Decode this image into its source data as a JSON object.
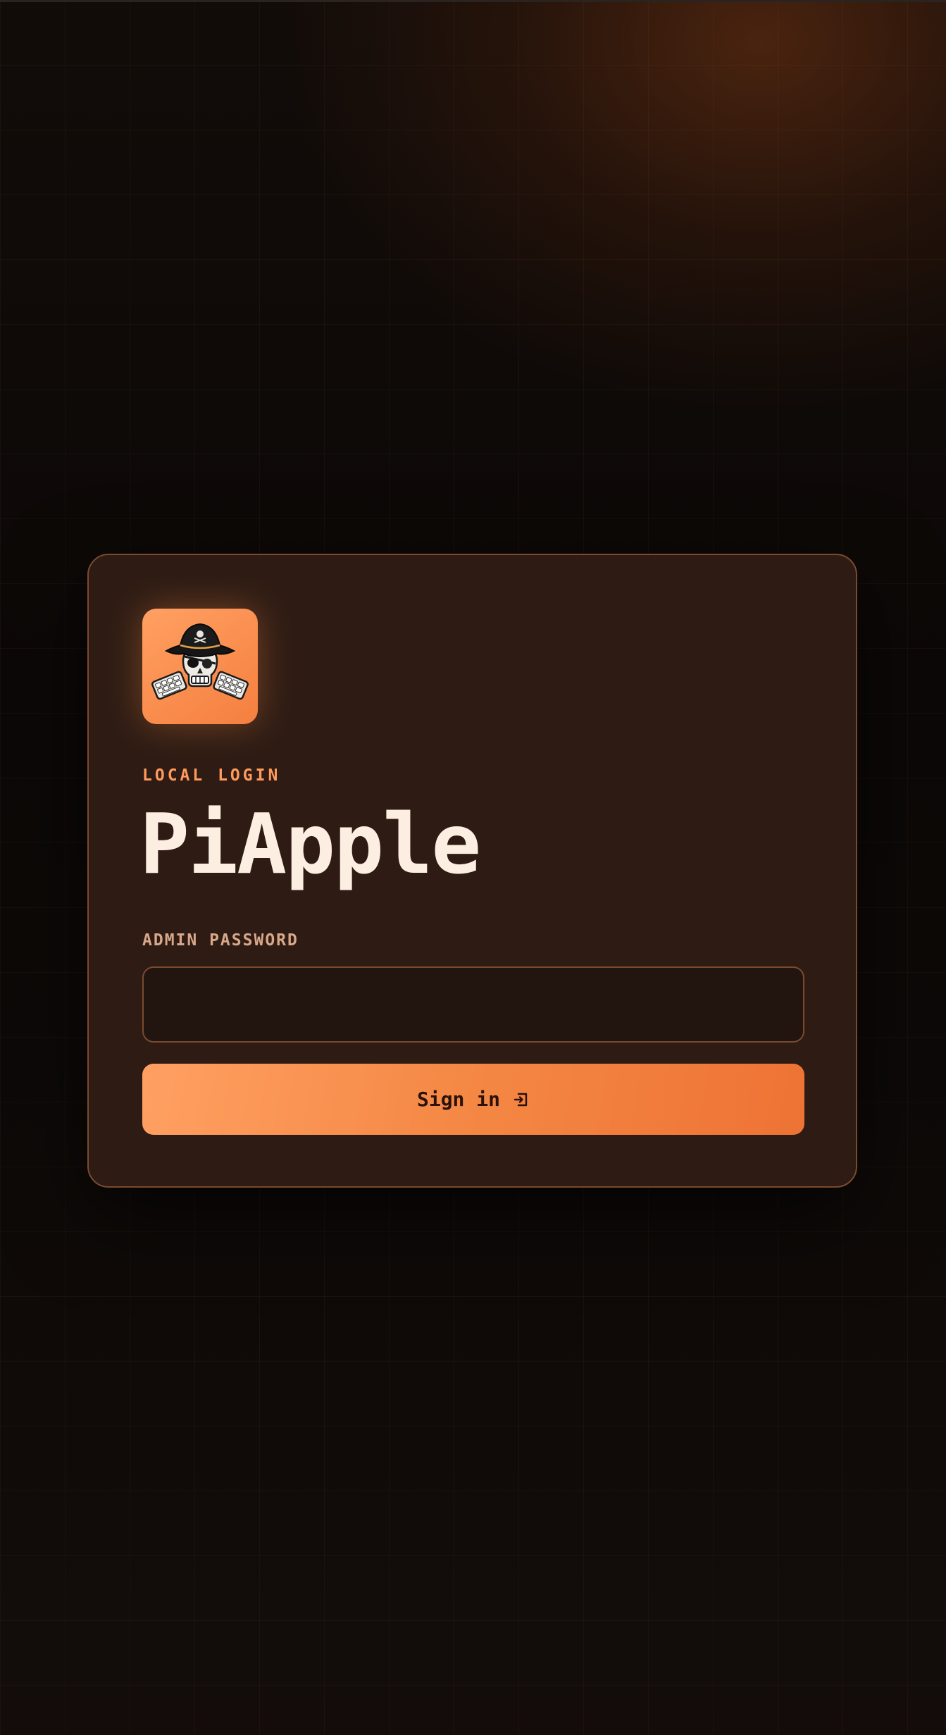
{
  "app": {
    "eyebrow": "LOCAL LOGIN",
    "title": "PiApple"
  },
  "logo": {
    "icon": "pirate-skull-keyboards-icon"
  },
  "form": {
    "password_label": "ADMIN PASSWORD",
    "password_value": "",
    "password_placeholder": "",
    "submit_label": "Sign in",
    "submit_icon": "sign-in-icon"
  },
  "colors": {
    "accent": "#ff9a5c",
    "button_start": "#ffa062",
    "button_end": "#ee7335",
    "card_bg": "#2e1c14",
    "card_border": "#7a4a2e",
    "title": "#fdeee2",
    "page_bg": "#0d0907"
  }
}
